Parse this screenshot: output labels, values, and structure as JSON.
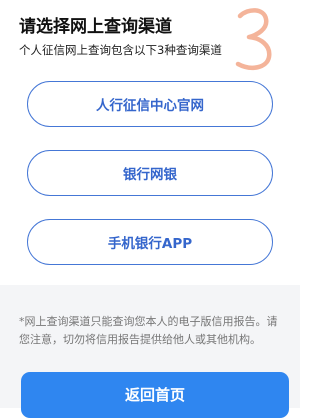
{
  "header": {
    "title": "请选择网上查询渠道",
    "subtitle": "个人征信网上查询包含以下3种查询渠道"
  },
  "overlay": {
    "step_number": "3",
    "step_color": "#f4b49a"
  },
  "channels": [
    {
      "label": "人行征信中心官网"
    },
    {
      "label": "银行网银"
    },
    {
      "label": "手机银行APP"
    }
  ],
  "notice": {
    "text": "*网上查询渠道只能查询您本人的电子版信用报告。请您注意，切勿将信用报告提供给他人或其他机构。"
  },
  "footer": {
    "home_button_label": "返回首页"
  },
  "colors": {
    "accent": "#2f86f0",
    "outline": "#4577d6",
    "link_text": "#3566cc",
    "panel_bg": "#f4f5f7"
  }
}
